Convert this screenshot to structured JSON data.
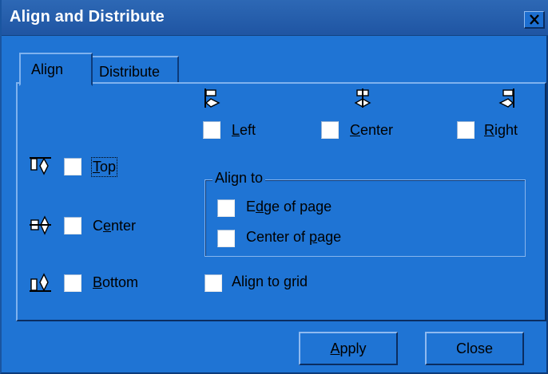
{
  "window": {
    "title": "Align and Distribute"
  },
  "tabs": [
    {
      "label": "Align"
    },
    {
      "label": "Distribute"
    }
  ],
  "horizontal": {
    "left": {
      "pre": "",
      "mnemonic": "L",
      "post": "eft",
      "icon": "align-left-icon"
    },
    "center": {
      "pre": "",
      "mnemonic": "C",
      "post": "enter",
      "icon": "align-center-horizontal-icon"
    },
    "right": {
      "pre": "",
      "mnemonic": "R",
      "post": "ight",
      "icon": "align-right-icon"
    }
  },
  "vertical": {
    "top": {
      "pre": "",
      "mnemonic": "T",
      "post": "op",
      "icon": "align-top-icon"
    },
    "center": {
      "pre": "C",
      "mnemonic": "e",
      "post": "nter",
      "icon": "align-center-vertical-icon"
    },
    "bottom": {
      "pre": "",
      "mnemonic": "B",
      "post": "ottom",
      "icon": "align-bottom-icon"
    }
  },
  "align_to": {
    "label": "Align to",
    "edge": {
      "pre": "E",
      "mnemonic": "d",
      "post": "ge of page"
    },
    "center": {
      "pre": "Center of ",
      "mnemonic": "p",
      "post": "age"
    }
  },
  "grid": {
    "pre": "Align to ",
    "mnemonic": "g",
    "post": "rid"
  },
  "buttons": {
    "apply": {
      "pre": "",
      "mnemonic": "A",
      "post": "pply"
    },
    "close": {
      "label": "Close"
    }
  },
  "colors": {
    "background": "#1f74d4",
    "titlebar": "#2560ad"
  }
}
